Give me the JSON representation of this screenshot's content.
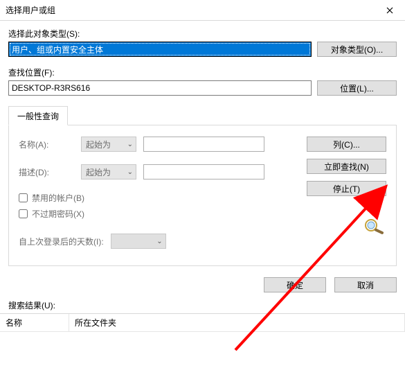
{
  "window": {
    "title": "选择用户或组"
  },
  "objectType": {
    "label": "选择此对象类型(S):",
    "value": "用户、组或内置安全主体",
    "button": "对象类型(O)..."
  },
  "location": {
    "label": "查找位置(F):",
    "value": "DESKTOP-R3RS616",
    "button": "位置(L)..."
  },
  "tabs": {
    "general": "一般性查询"
  },
  "form": {
    "nameLabel": "名称(A):",
    "descLabel": "描述(D):",
    "startsWith": "起始为",
    "disabledAccounts": "禁用的帐户(B)",
    "neverExpire": "不过期密码(X)",
    "daysSinceLogon": "自上次登录后的天数(I):"
  },
  "rightButtons": {
    "columns": "列(C)...",
    "findNow": "立即查找(N)",
    "stop": "停止(T)"
  },
  "bottom": {
    "ok": "确定",
    "cancel": "取消"
  },
  "results": {
    "label": "搜索结果(U):",
    "colName": "名称",
    "colFolder": "所在文件夹"
  }
}
